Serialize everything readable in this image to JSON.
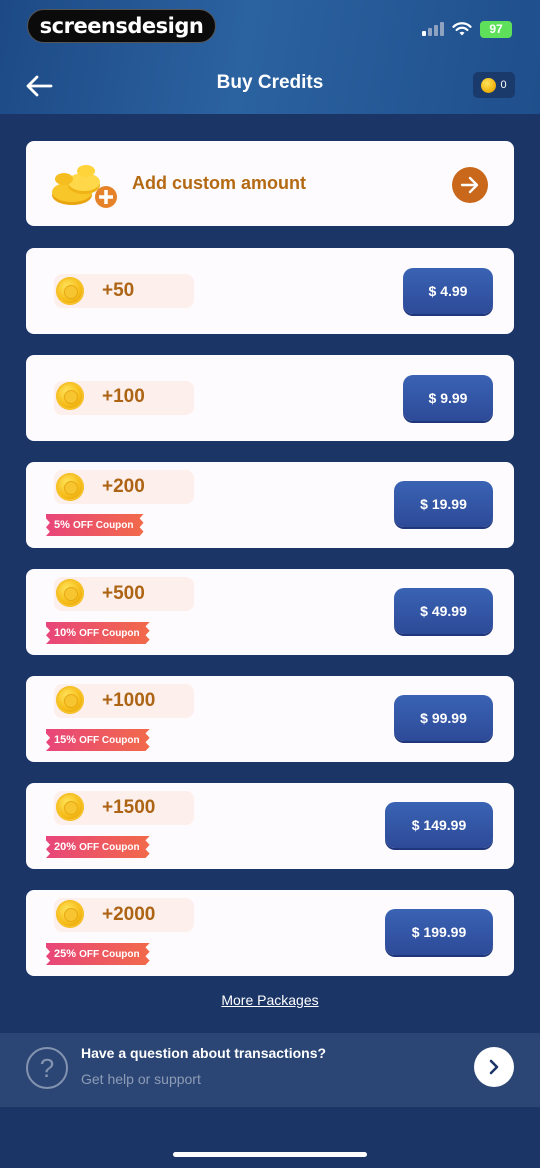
{
  "watermark": "screensdesign",
  "status": {
    "battery": "97"
  },
  "header": {
    "title": "Buy Credits",
    "balance": "0"
  },
  "custom": {
    "label": "Add custom amount"
  },
  "packages": [
    {
      "amount": "+50",
      "price": "$ 4.99",
      "coupon": ""
    },
    {
      "amount": "+100",
      "price": "$ 9.99",
      "coupon": ""
    },
    {
      "amount": "+200",
      "price": "$ 19.99",
      "coupon_pct": "5%",
      "coupon_text": "OFF Coupon"
    },
    {
      "amount": "+500",
      "price": "$ 49.99",
      "coupon_pct": "10%",
      "coupon_text": "OFF Coupon"
    },
    {
      "amount": "+1000",
      "price": "$ 99.99",
      "coupon_pct": "15%",
      "coupon_text": "OFF Coupon"
    },
    {
      "amount": "+1500",
      "price": "$ 149.99",
      "coupon_pct": "20%",
      "coupon_text": "OFF Coupon"
    },
    {
      "amount": "+2000",
      "price": "$ 199.99",
      "coupon_pct": "25%",
      "coupon_text": "OFF Coupon"
    }
  ],
  "more_packages": "More Packages",
  "help": {
    "title": "Have a question about transactions?",
    "subtitle": "Get help or support"
  },
  "icons": [
    "back-arrow-icon",
    "coin-icon",
    "coins-pile-icon",
    "arrow-right-icon",
    "question-icon",
    "chevron-right-icon",
    "wifi-icon",
    "signal-icon",
    "battery-icon"
  ],
  "colors": {
    "background": "#1b3567",
    "card": "#fdfbfd",
    "amount_text": "#ad6414",
    "button": "#2f4e9c",
    "coupon": "#e8457a"
  }
}
